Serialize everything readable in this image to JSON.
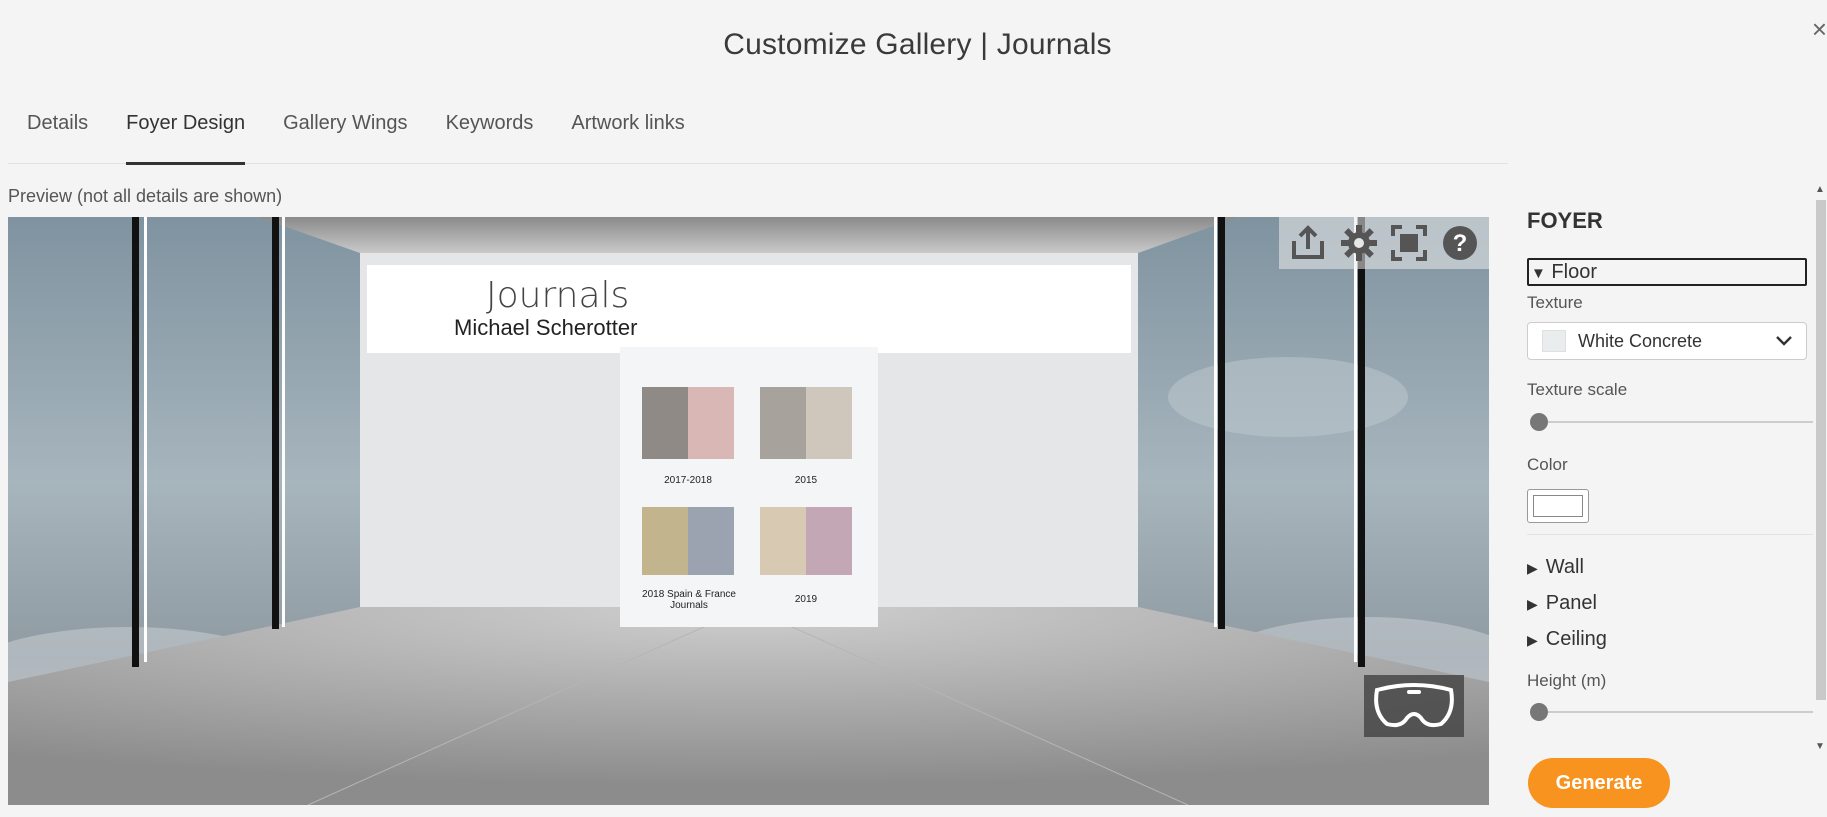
{
  "dialog": {
    "title": "Customize Gallery | Journals",
    "close": "×"
  },
  "tabs": [
    {
      "label": "Details"
    },
    {
      "label": "Foyer Design"
    },
    {
      "label": "Gallery Wings"
    },
    {
      "label": "Keywords"
    },
    {
      "label": "Artwork links"
    }
  ],
  "active_tab": "Foyer Design",
  "preview": {
    "label": "Preview (not all details are shown)",
    "banner_title": "Journals",
    "banner_artist": "Michael Scherotter",
    "journals": [
      "2017-2018",
      "2015",
      "2018 Spain & France Journals",
      "2019"
    ],
    "toolbar_icons": [
      "share-icon",
      "gear-icon",
      "fullscreen-icon",
      "help-icon"
    ],
    "vr_icon": "vr-headset-icon"
  },
  "panel": {
    "heading": "FOYER",
    "floor": {
      "label": "Floor",
      "texture_label": "Texture",
      "texture_value": "White Concrete",
      "texture_scale_label": "Texture scale",
      "texture_scale_value": 0,
      "color_label": "Color",
      "color_value": "#ffffff"
    },
    "sections": [
      "Wall",
      "Panel",
      "Ceiling"
    ],
    "height_label": "Height (m)",
    "height_value": 0
  },
  "actions": {
    "generate": "Generate"
  },
  "colors": {
    "accent": "#f7931e",
    "sky": "#9aa9b3",
    "floor": "#a9a9a9"
  }
}
